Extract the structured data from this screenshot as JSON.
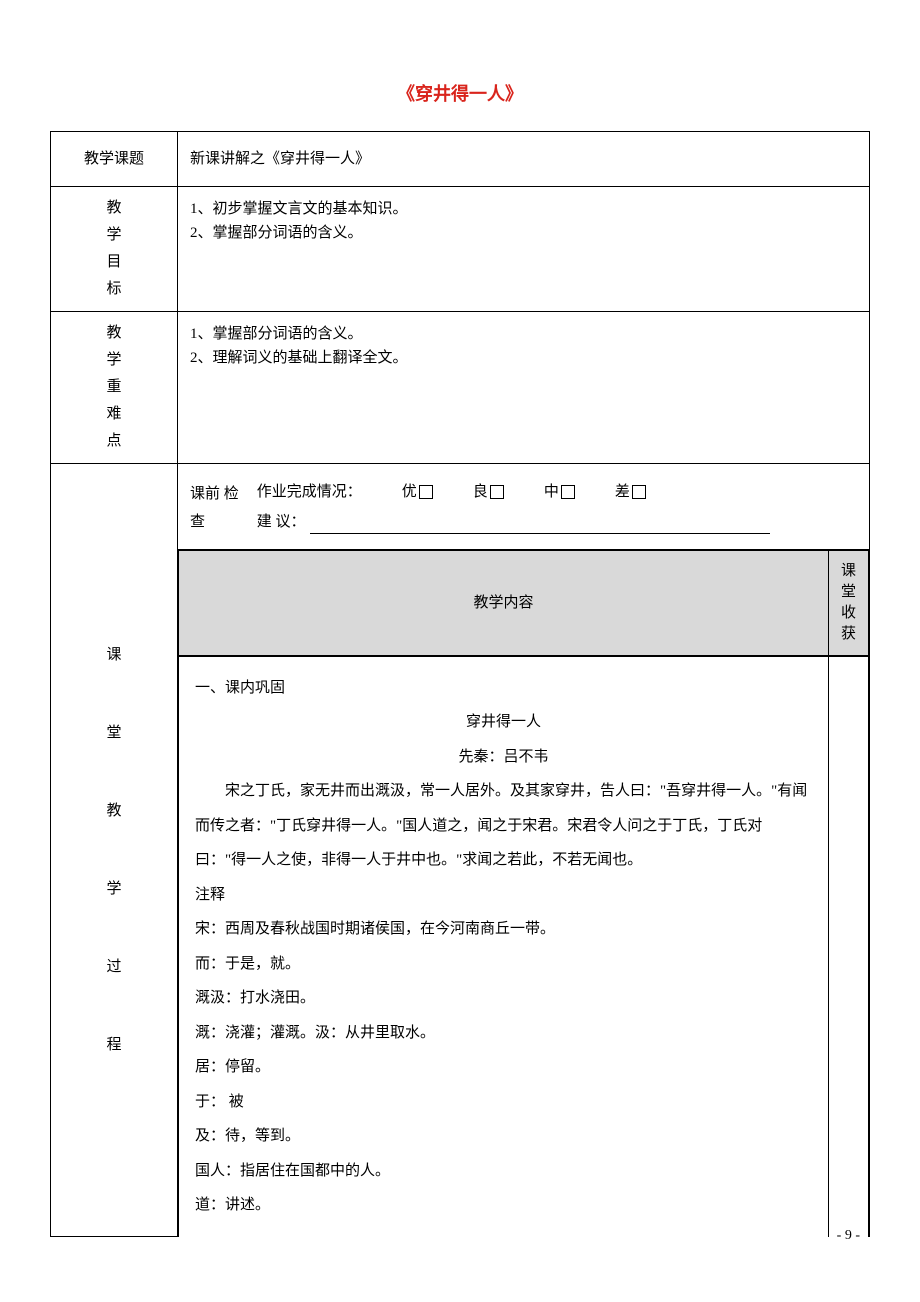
{
  "title": "《穿井得一人》",
  "rows": {
    "course_label": "教学课题",
    "course_value": "新课讲解之《穿井得一人》",
    "goals_label": "教学目标",
    "goals_lines": [
      "1、初步掌握文言文的基本知识。",
      "2、掌握部分词语的含义。"
    ],
    "diff_label": "教学重难点",
    "diff_lines": [
      "1、掌握部分词语的含义。",
      "2、理解词义的基础上翻译全文。"
    ],
    "process_label": "课堂教学过程",
    "precheck_label": "课前 检查",
    "hw_label": "作业完成情况：",
    "grades": [
      "优",
      "良",
      "中",
      "差"
    ],
    "suggest_label": "建   议：",
    "content_header": "教学内容",
    "harvest_header": "课堂收获",
    "section1_title": "一、课内巩固",
    "poem_title": "穿井得一人",
    "poem_author": "先秦：吕不韦",
    "passage": "宋之丁氏，家无井而出溉汲，常一人居外。及其家穿井，告人曰：\"吾穿井得一人。\"有闻而传之者：\"丁氏穿井得一人。\"国人道之，闻之于宋君。宋君令人问之于丁氏，丁氏对曰：\"得一人之使，非得一人于井中也。\"求闻之若此，不若无闻也。",
    "notes_title": "注释",
    "notes": [
      "宋：西周及春秋战国时期诸侯国，在今河南商丘一带。",
      "而：于是，就。",
      "溉汲：打水浇田。",
      "溉：浇灌；灌溉。汲：从井里取水。",
      "居：停留。",
      "于：  被",
      "及：待，等到。",
      "国人：指居住在国都中的人。",
      "道：讲述。"
    ]
  },
  "page_number": "- 9 -"
}
